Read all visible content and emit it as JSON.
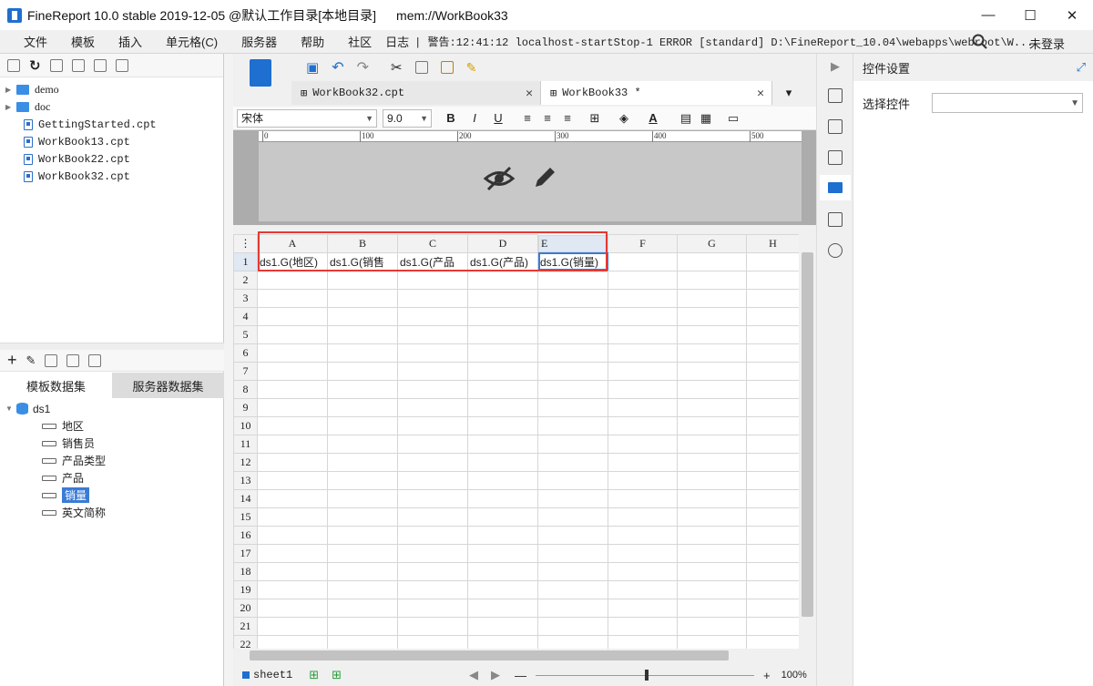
{
  "window": {
    "title": "FineReport 10.0 stable 2019-12-05 @默认工作目录[本地目录]",
    "path": "mem://WorkBook33"
  },
  "menu": {
    "items": [
      "文件",
      "模板",
      "插入",
      "单元格(C)",
      "服务器",
      "帮助",
      "社区",
      "日志"
    ],
    "log": "| 警告:12:41:12 localhost-startStop-1 ERROR [standard] D:\\FineReport_10.04\\webapps\\webroot\\W...",
    "login": "未登录"
  },
  "file_tree": [
    {
      "name": "demo",
      "type": "folder"
    },
    {
      "name": "doc",
      "type": "folder"
    },
    {
      "name": "GettingStarted.cpt",
      "type": "file"
    },
    {
      "name": "WorkBook13.cpt",
      "type": "file"
    },
    {
      "name": "WorkBook22.cpt",
      "type": "file"
    },
    {
      "name": "WorkBook32.cpt",
      "type": "file"
    }
  ],
  "dataset_tabs": [
    "模板数据集",
    "服务器数据集"
  ],
  "dataset": {
    "name": "ds1",
    "fields": [
      "地区",
      "销售员",
      "产品类型",
      "产品",
      "销量",
      "英文简称"
    ],
    "selected_field": "销量"
  },
  "doc_tabs": [
    {
      "label": "WorkBook32.cpt",
      "active": false
    },
    {
      "label": "WorkBook33 *",
      "active": true
    }
  ],
  "format": {
    "font": "宋体",
    "size": "9.0"
  },
  "ruler_ticks": [
    "0",
    "100",
    "200",
    "300",
    "400",
    "500"
  ],
  "grid": {
    "columns": [
      "A",
      "B",
      "C",
      "D",
      "E",
      "F",
      "G",
      "H"
    ],
    "rows": [
      "1",
      "2",
      "3",
      "4",
      "5",
      "6",
      "7",
      "8",
      "9",
      "10",
      "11",
      "12",
      "13",
      "14",
      "15",
      "16",
      "17",
      "18",
      "19",
      "20",
      "21",
      "22"
    ],
    "row1": [
      "ds1.G(地区)",
      "ds1.G(销售",
      "ds1.G(产品",
      "ds1.G(产品)",
      "ds1.G(销量)",
      "",
      "",
      ""
    ],
    "selected_column": "E"
  },
  "sheet": {
    "name": "sheet1",
    "zoom": "100%"
  },
  "control_panel": {
    "title": "控件设置",
    "select_label": "选择控件",
    "select_value": ""
  },
  "colors": {
    "accent": "#1e6fd0",
    "highlight": "#e53935",
    "selection": "#3a7bd5"
  }
}
